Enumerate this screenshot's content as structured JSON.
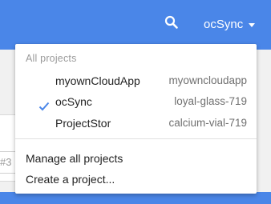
{
  "topbar": {
    "search_icon": "search-icon",
    "current_project": "ocSync",
    "color": "#4a86e8"
  },
  "background": {
    "input_fragment": "#3"
  },
  "dropdown": {
    "header": "All projects",
    "projects": [
      {
        "name": "myownCloudApp",
        "id": "myowncloudapp",
        "selected": false
      },
      {
        "name": "ocSync",
        "id": "loyal-glass-719",
        "selected": true
      },
      {
        "name": "ProjectStor",
        "id": "calcium-vial-719",
        "selected": false
      }
    ],
    "actions": {
      "manage": "Manage all projects",
      "create": "Create a project..."
    },
    "check_color": "#4a86e8"
  }
}
